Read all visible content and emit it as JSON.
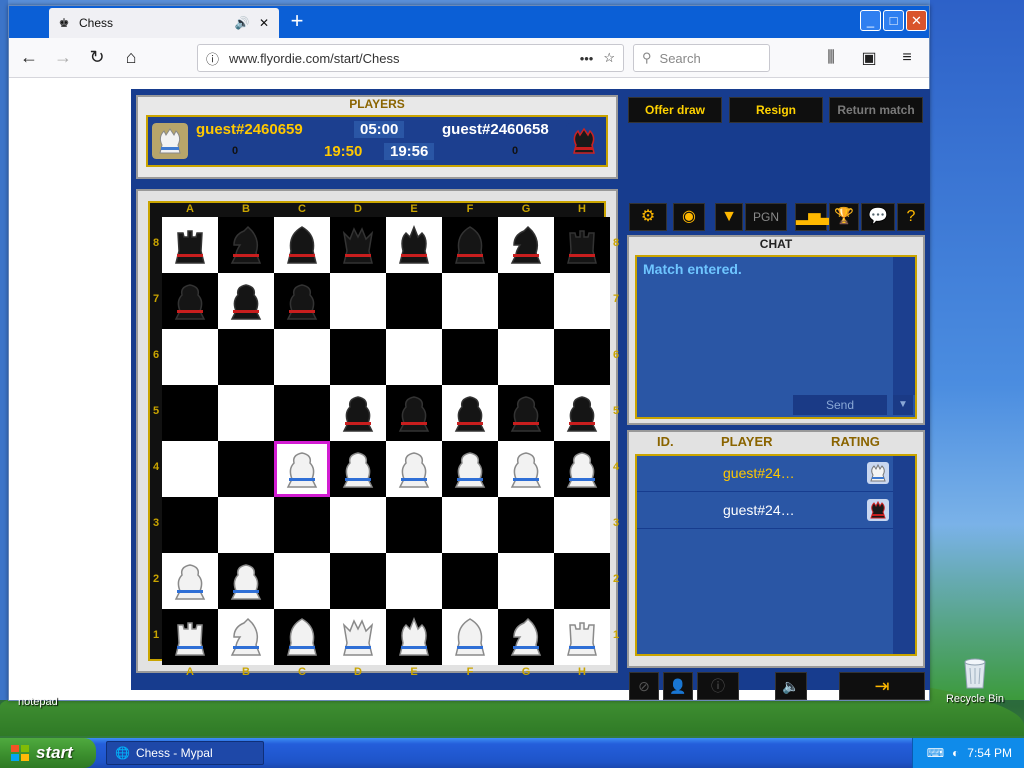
{
  "browser": {
    "tab_title": "Chess",
    "url": "www.flyordie.com/start/Chess",
    "search_placeholder": "Search",
    "url_more": "•••",
    "new_tab": "+"
  },
  "game": {
    "players_header": "PLAYERS",
    "white_player": "guest#2460659",
    "black_player": "guest#2460658",
    "white_clock_main": "05:00",
    "white_clock_total": "19:50",
    "black_clock_total": "19:56",
    "white_score": "0",
    "black_score": "0",
    "buttons": {
      "offer_draw": "Offer draw",
      "resign": "Resign",
      "return_match": "Return match"
    },
    "pgn_label": "PGN",
    "chat": {
      "header": "CHAT",
      "message": "Match entered.",
      "send": "Send"
    },
    "player_list": {
      "col_id": "ID.",
      "col_player": "PLAYER",
      "col_rating": "RATING",
      "rows": [
        {
          "name": "guest#24…",
          "color": "#ffc800",
          "side": "white"
        },
        {
          "name": "guest#24…",
          "color": "#ffffff",
          "side": "black"
        }
      ]
    },
    "files": [
      "A",
      "B",
      "C",
      "D",
      "E",
      "F",
      "G",
      "H"
    ],
    "ranks": [
      "8",
      "7",
      "6",
      "5",
      "4",
      "3",
      "2",
      "1"
    ],
    "board": [
      [
        "bR",
        "bN",
        "bB",
        "bQ",
        "bK",
        "bB",
        "bN",
        "bR"
      ],
      [
        "bP",
        "bP",
        "bP",
        "",
        "",
        "",
        "",
        ""
      ],
      [
        "",
        "",
        "",
        "",
        "",
        "",
        "",
        ""
      ],
      [
        "",
        "",
        "",
        "bP",
        "bP",
        "bP",
        "bP",
        "bP"
      ],
      [
        "",
        "",
        "wP",
        "wP",
        "wP",
        "wP",
        "wP",
        "wP"
      ],
      [
        "",
        "",
        "",
        "",
        "",
        "",
        "",
        ""
      ],
      [
        "wP",
        "wP",
        "",
        "",
        "",
        "",
        "",
        ""
      ],
      [
        "wR",
        "wN",
        "wB",
        "wQ",
        "wK",
        "wB",
        "wN",
        "wR"
      ]
    ],
    "selected_square": "C4"
  },
  "desktop": {
    "recycle_bin": "Recycle Bin",
    "notepad": "notepad"
  },
  "taskbar": {
    "start": "start",
    "task": "Chess - Mypal",
    "clock": "7:54 PM"
  },
  "colors": {
    "accent_gold": "#ffc800",
    "panel_blue": "#1c3f8f",
    "selection": "#d21cd2"
  }
}
